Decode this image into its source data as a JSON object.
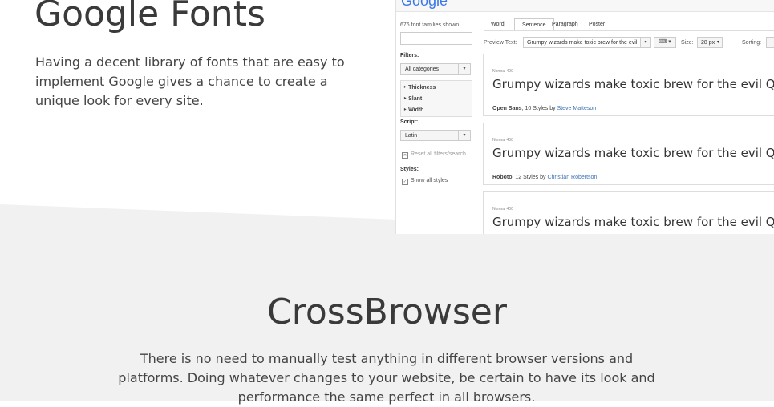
{
  "google_fonts": {
    "title": "Google Fonts",
    "description": "Having a decent library of fonts that are easy to implement Google gives a chance to create a unique look for every site."
  },
  "screenshot": {
    "logo": "Google",
    "families_shown": "676 font families shown",
    "filters_label": "Filters:",
    "category_value": "All categories",
    "filter_items": [
      "Thickness",
      "Slant",
      "Width"
    ],
    "script_label": "Script:",
    "script_value": "Latin",
    "reset_label": "Reset all filters/search",
    "styles_label": "Styles:",
    "show_all_styles": "Show all styles",
    "tabs": [
      "Word",
      "Sentence",
      "Paragraph",
      "Poster"
    ],
    "active_tab": "Sentence",
    "preview_text_label": "Preview Text:",
    "preview_text_value": "Grumpy wizards make toxic brew for the evil",
    "size_label": "Size:",
    "size_value": "28 px",
    "sorting_label": "Sorting:",
    "cards": [
      {
        "style": "Normal 400",
        "sample": "Grumpy wizards make toxic brew for the evil Quee",
        "family": "Open Sans",
        "styles": ", 10 Styles by ",
        "author": "Steve Matteson"
      },
      {
        "style": "Normal 400",
        "sample": "Grumpy wizards make toxic brew for the evil Queen a",
        "family": "Roboto",
        "styles": ", 12 Styles by ",
        "author": "Christian Robertson"
      },
      {
        "style": "Normal 400",
        "sample": "Grumpy wizards make toxic brew for the evil Queen a",
        "family": "",
        "styles": "",
        "author": ""
      }
    ]
  },
  "cross_browser": {
    "title": "CrossBrowser",
    "description": "There is no need to manually test anything in different browser versions and platforms. Doing whatever changes to your website, be certain to have its look and performance the same perfect in all browsers."
  },
  "colors": {
    "accent_blue": "#3b78e7",
    "link_blue": "#3b6fb6",
    "section_gray": "#f1f1f1"
  }
}
